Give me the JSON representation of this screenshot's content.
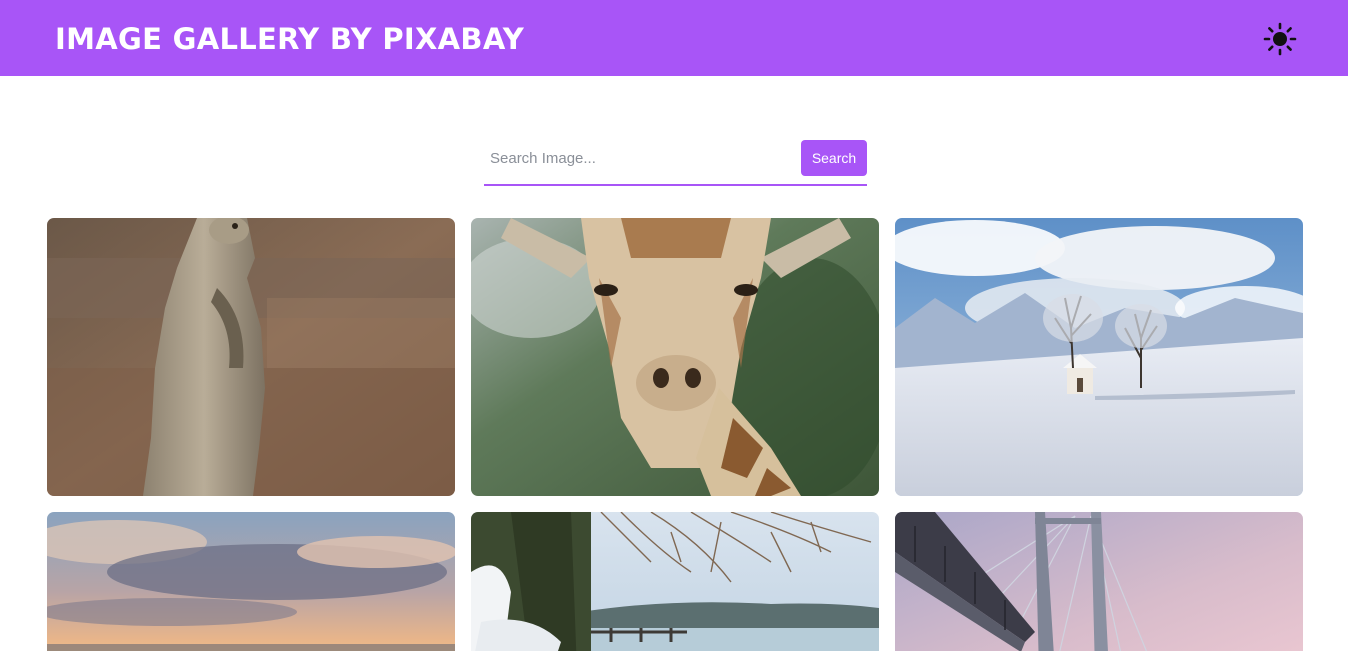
{
  "header": {
    "title": "IMAGE GALLERY BY PIXABAY",
    "theme_icon": "sun-icon",
    "background": "#a855f7"
  },
  "search": {
    "placeholder": "Search Image...",
    "value": "",
    "button_label": "Search",
    "accent": "#a855f7"
  },
  "gallery": {
    "images": [
      {
        "subject": "meerkat",
        "alt": "Meerkat standing"
      },
      {
        "subject": "giraffe",
        "alt": "Giraffe close-up"
      },
      {
        "subject": "snowy-landscape",
        "alt": "Snowy field with trees and mountains"
      },
      {
        "subject": "sunset-sky",
        "alt": "Sunset sky with clouds"
      },
      {
        "subject": "snowy-lake",
        "alt": "Snowy lakeshore with pier"
      },
      {
        "subject": "bridge",
        "alt": "Cable-stayed bridge at dusk"
      }
    ]
  }
}
